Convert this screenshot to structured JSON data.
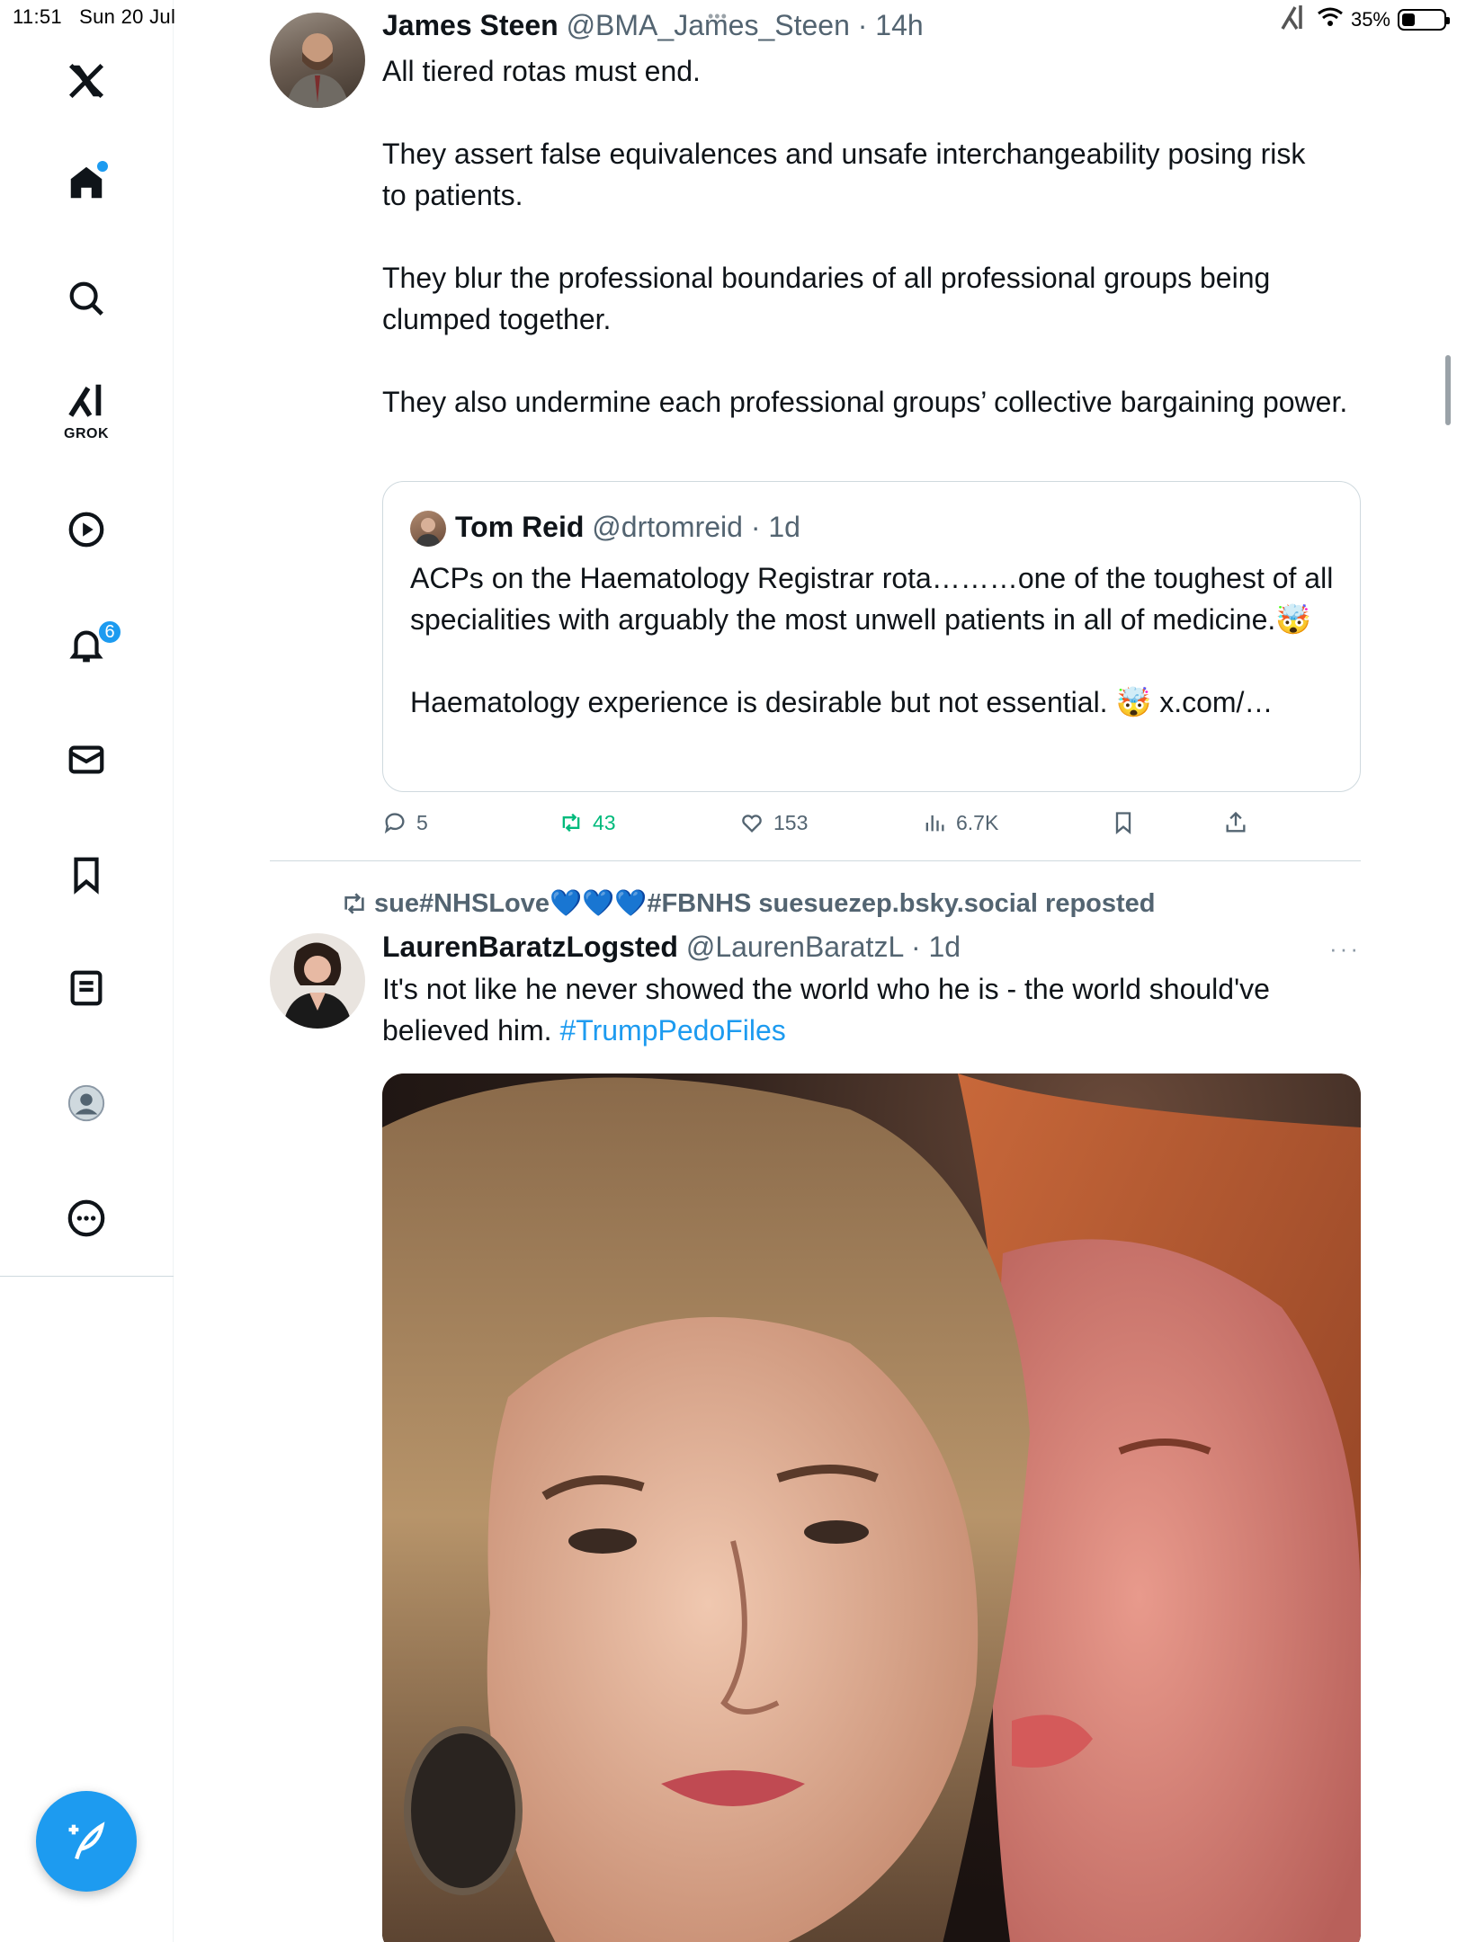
{
  "status_bar": {
    "time": "11:51",
    "date": "Sun 20 Jul",
    "battery": "35%"
  },
  "sidebar": {
    "items": [
      {
        "name": "x-logo-icon"
      },
      {
        "name": "home-icon",
        "has_dot": true
      },
      {
        "name": "search-icon"
      },
      {
        "name": "grok-icon",
        "label": "GROK"
      },
      {
        "name": "video-icon"
      },
      {
        "name": "notifications-icon",
        "badge": "6"
      },
      {
        "name": "messages-icon"
      },
      {
        "name": "bookmarks-icon"
      },
      {
        "name": "lists-icon"
      },
      {
        "name": "profile-icon"
      },
      {
        "name": "more-icon"
      }
    ],
    "compose_icon": "compose-post-icon"
  },
  "tweet1": {
    "name": "James Steen",
    "handle": "@BMA_James_Steen",
    "sep": " · ",
    "time": "14h",
    "paragraphs": [
      "All tiered rotas must end.",
      "They assert false equivalences and unsafe interchangeability posing risk to patients.",
      "They blur the professional boundaries of all professional groups being clumped together.",
      "They also undermine each professional groups’ collective bargaining power."
    ],
    "quote": {
      "name": "Tom Reid",
      "handle": "@drtomreid",
      "sep": " · ",
      "time": "1d",
      "p1": "ACPs on the Haematology Registrar rota………one of the toughest of all specialities with arguably the most unwell patients in all of medicine.🤯",
      "p2": "Haematology experience is desirable but not essential. 🤯 x.com/…"
    },
    "actions": {
      "replies": "5",
      "reposts": "43",
      "likes": "153",
      "views": "6.7K"
    }
  },
  "tweet2": {
    "repost_by": "sue#NHSLove💙💙💙#FBNHS suesuezep.bsky.social reposted",
    "name": "LaurenBaratzLogsted",
    "handle": "@LaurenBaratzL",
    "sep": " · ",
    "time": "1d",
    "text": "It's not like he never showed the world who he is - the world should've believed him.",
    "hashtag": "#TrumpPedoFiles",
    "more": "···"
  },
  "colors": {
    "accent": "#1d9bf0",
    "repost_green": "#00ba7c",
    "secondary_text": "#536471",
    "border": "#cfd9de"
  }
}
